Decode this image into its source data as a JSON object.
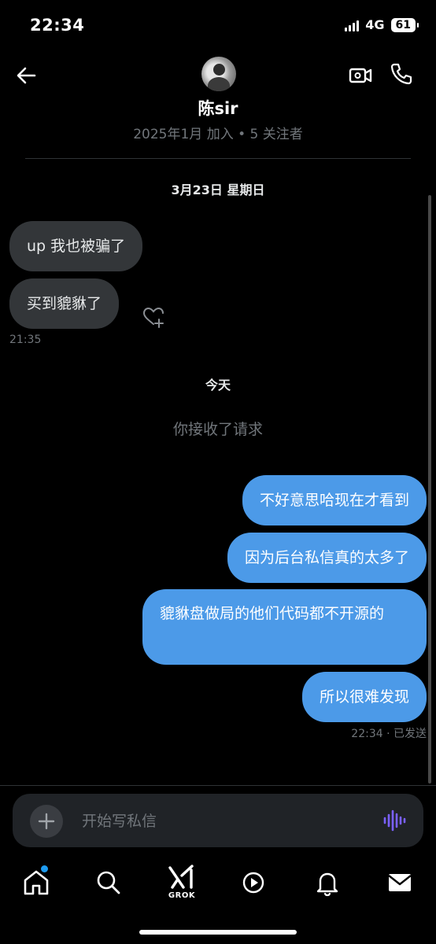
{
  "status_bar": {
    "time": "22:34",
    "network": "4G",
    "battery": "61"
  },
  "header": {
    "contact_name": "陈sir",
    "icons": [
      "back-arrow-icon",
      "video-call-icon",
      "phone-icon"
    ]
  },
  "profile_info": "2025年1月 加入 • 5 关注者",
  "conversation": {
    "date_1": "3月23日 星期日",
    "incoming": [
      {
        "text": "up 我也被骗了"
      },
      {
        "text": "买到貔貅了"
      }
    ],
    "incoming_time": "21:35",
    "date_2": "今天",
    "system_message": "你接收了请求",
    "outgoing": [
      {
        "text": "不好意思哈现在才看到"
      },
      {
        "text": "因为后台私信真的太多了"
      },
      {
        "text": "貔貅盘做局的他们代码都不开源的"
      },
      {
        "text": "所以很难发现"
      }
    ],
    "outgoing_status": "22:34 · 已发送"
  },
  "composer": {
    "placeholder": "开始写私信"
  },
  "tabbar": {
    "items": [
      "home-icon",
      "search-icon",
      "grok-icon",
      "play-icon",
      "bell-icon",
      "mail-icon"
    ],
    "grok_label": "GROK"
  },
  "colors": {
    "background": "#000000",
    "outgoing_bubble": "#4c9ae8",
    "incoming_bubble": "#333639",
    "muted_text": "#71767b",
    "accent_dot": "#1d9bf0",
    "voice_icon": "#7b61ff"
  }
}
